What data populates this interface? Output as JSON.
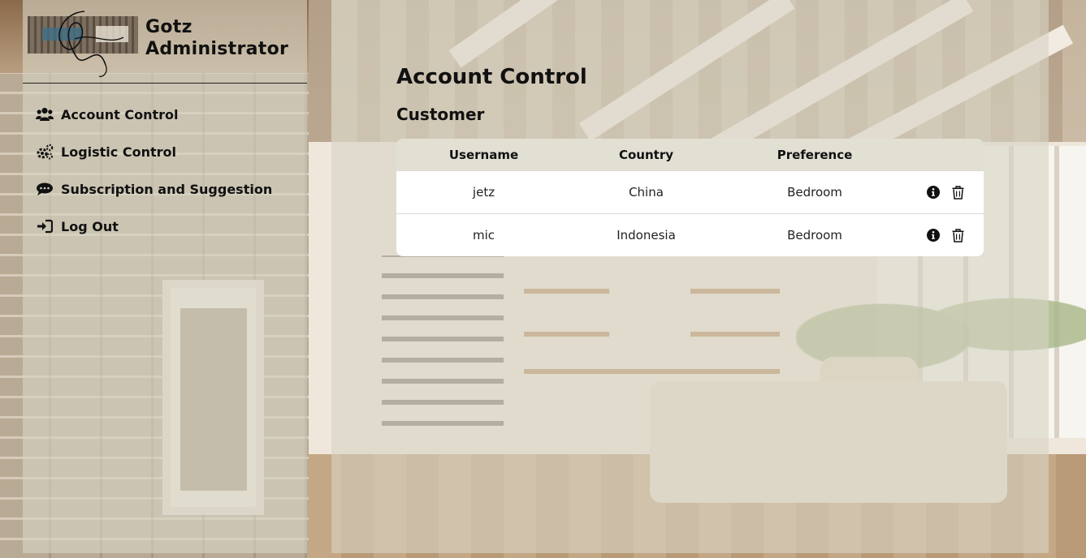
{
  "brand": {
    "line1": "Gotz",
    "line2": "Administrator",
    "logo_icon": "signature-logo"
  },
  "nav": [
    {
      "label": "Account Control",
      "icon": "users-icon"
    },
    {
      "label": "Logistic Control",
      "icon": "cogs-icon"
    },
    {
      "label": "Subscription and Suggestion",
      "icon": "comments-icon"
    },
    {
      "label": "Log Out",
      "icon": "sign-out-icon"
    }
  ],
  "main": {
    "title": "Account Control",
    "section": "Customer",
    "table": {
      "headers": [
        "Username",
        "Country",
        "Preference",
        ""
      ],
      "rows": [
        {
          "username": "jetz",
          "country": "China",
          "preference": "Bedroom"
        },
        {
          "username": "mic",
          "country": "Indonesia",
          "preference": "Bedroom"
        }
      ],
      "actions": [
        "info-icon",
        "trash-icon"
      ]
    }
  },
  "colors": {
    "panel": "#d6d4c4",
    "table_header": "#e2e0d3",
    "text": "#111111"
  }
}
